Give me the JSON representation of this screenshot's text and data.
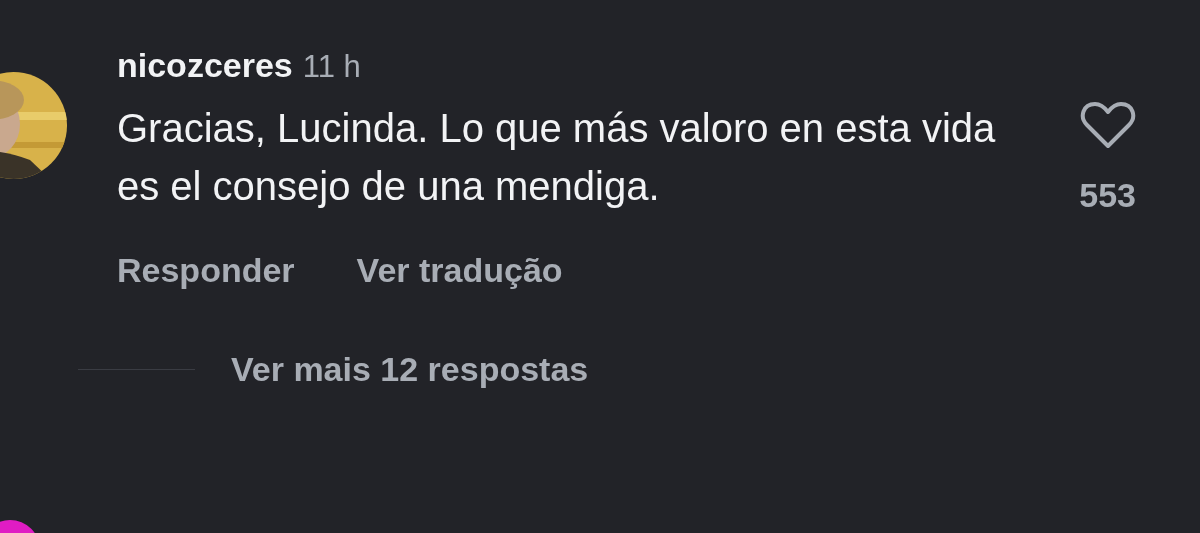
{
  "comment": {
    "username": "nicozceres",
    "time": "11 h",
    "text": "Gracias, Lucinda. Lo que más valoro en esta vida es el consejo de una mendiga.",
    "liked": false,
    "likes": "553",
    "actions": [
      "Responder",
      "Ver tradução"
    ]
  },
  "replies_link": "Ver mais 12 respostas"
}
